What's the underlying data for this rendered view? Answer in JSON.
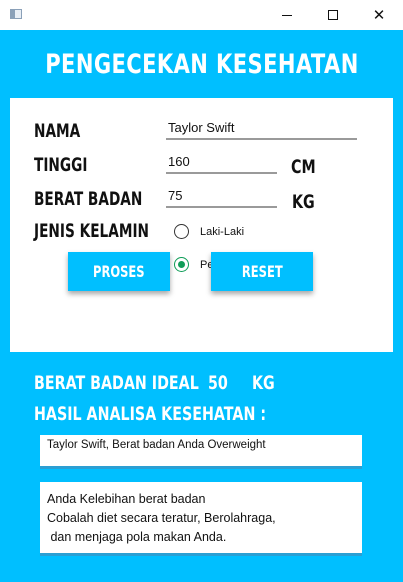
{
  "window": {
    "icon": "app-window-icon",
    "controls": {
      "minimize": "minimize-icon",
      "maximize": "maximize-icon",
      "close": "close-icon"
    }
  },
  "colors": {
    "accent": "#00bfff",
    "panel": "#ffffff",
    "radio_checked": "#0f9d58"
  },
  "header": {
    "title": "PENGECEKAN KESEHATAN"
  },
  "form": {
    "nama_label": "NAMA",
    "nama_value": "Taylor Swift",
    "tinggi_label": "TINGGI",
    "tinggi_value": "160",
    "tinggi_unit": "CM",
    "berat_label": "BERAT BADAN",
    "berat_value": "75",
    "berat_unit": "KG",
    "gender_label": "JENIS KELAMIN",
    "gender_options": [
      {
        "label": "Laki-Laki",
        "selected": false
      },
      {
        "label": "Perempuan",
        "selected": true
      }
    ]
  },
  "buttons": {
    "proses": "PROSES",
    "reset": "RESET"
  },
  "result": {
    "ideal_label": "BERAT BADAN IDEAL",
    "ideal_value": "50",
    "ideal_unit": "KG",
    "analysis_label": "HASIL ANALISA KESEHATAN :",
    "summary": "Taylor Swift, Berat badan Anda Overweight",
    "advice_lines": [
      "Anda Kelebihan berat badan",
      "Cobalah diet secara teratur, Berolahraga,",
      " dan menjaga pola makan Anda."
    ]
  }
}
